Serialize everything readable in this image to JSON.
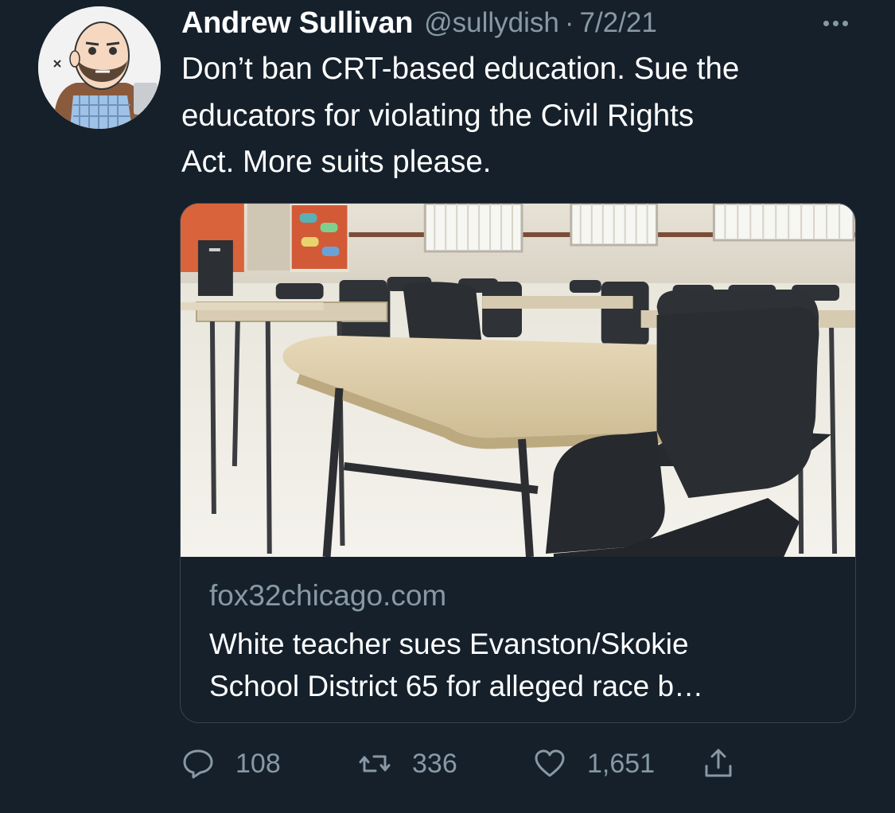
{
  "tweet": {
    "author_name": "Andrew Sullivan",
    "handle": "@sullydish",
    "separator": "·",
    "date": "7/2/21",
    "text": "Don’t ban CRT-based education. Sue the\neducators for violating the Civil Rights\nAct. More suits please.",
    "more_icon": "more-horizontal-icon"
  },
  "card": {
    "image_icon": "classroom-photo",
    "domain": "fox32chicago.com",
    "title": "White teacher sues Evanston/Skokie\nSchool District 65 for alleged race b…"
  },
  "actions": {
    "reply": {
      "icon": "reply-icon",
      "count": "108"
    },
    "retweet": {
      "icon": "retweet-icon",
      "count": "336"
    },
    "like": {
      "icon": "heart-icon",
      "count": "1,651"
    },
    "share": {
      "icon": "share-icon"
    }
  },
  "colors": {
    "background": "#15202b",
    "secondary_text": "#8899a6",
    "border": "#38444d",
    "primary_text": "#ffffff"
  }
}
